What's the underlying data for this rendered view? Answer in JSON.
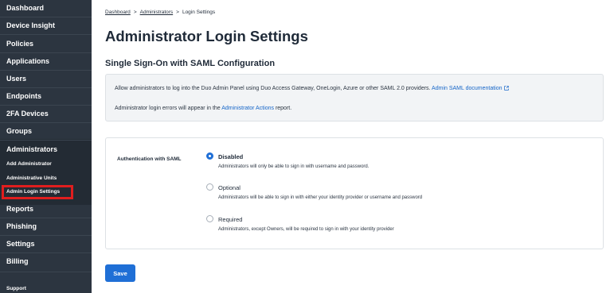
{
  "sidebar": {
    "items": [
      {
        "label": "Dashboard"
      },
      {
        "label": "Device Insight"
      },
      {
        "label": "Policies"
      },
      {
        "label": "Applications"
      },
      {
        "label": "Users"
      },
      {
        "label": "Endpoints"
      },
      {
        "label": "2FA Devices"
      },
      {
        "label": "Groups"
      },
      {
        "label": "Administrators"
      },
      {
        "label": "Reports"
      },
      {
        "label": "Phishing"
      },
      {
        "label": "Settings"
      },
      {
        "label": "Billing"
      },
      {
        "label": "Support"
      }
    ],
    "sub_items": [
      {
        "label": "Add Administrator"
      },
      {
        "label": "Administrative Units"
      },
      {
        "label": "Admin Login Settings"
      }
    ],
    "active_sub_item": "Admin Login Settings"
  },
  "breadcrumb": {
    "items": [
      "Dashboard",
      "Administrators",
      "Login Settings"
    ],
    "separator": ">"
  },
  "page": {
    "title": "Administrator Login Settings",
    "section_title": "Single Sign-On with SAML Configuration"
  },
  "info": {
    "line1_text": "Allow administrators to log into the Duo Admin Panel using Duo Access Gateway, OneLogin, Azure or other SAML 2.0 providers.",
    "line1_link": "Admin SAML documentation",
    "line2_prefix": "Administrator login errors will appear in the",
    "line2_link": "Administrator Actions",
    "line2_suffix": "report."
  },
  "saml": {
    "field_label": "Authentication with SAML",
    "selected": "Disabled",
    "options": [
      {
        "label": "Disabled",
        "description": "Administrators will only be able to sign in with username and password."
      },
      {
        "label": "Optional",
        "description": "Administrators will be able to sign in with either your identity provider or username and password"
      },
      {
        "label": "Required",
        "description": "Administrators, except Owners, will be required to sign in with your identity provider"
      }
    ]
  },
  "actions": {
    "save_label": "Save"
  },
  "colors": {
    "sidebar_bg": "#2c3540",
    "accent": "#1f6fd6",
    "link": "#1565c8",
    "active_outline": "#e01e1e"
  }
}
